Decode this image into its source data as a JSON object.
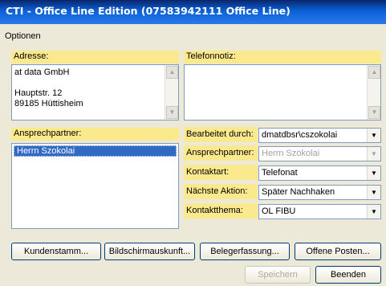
{
  "window": {
    "title": "CTI - Office Line Edition (07583942111 Office Line)"
  },
  "menu": {
    "optionen": "Optionen"
  },
  "address": {
    "label": "Adresse:",
    "text": "at data GmbH\n\nHauptstr. 12\n89185 Hüttisheim"
  },
  "telefonnotiz": {
    "label": "Telefonnotiz:",
    "text": ""
  },
  "contacts": {
    "label": "Ansprechpartner:",
    "items": [
      "Herrn Szokolai"
    ]
  },
  "form": {
    "bearbeitet": {
      "label": "Bearbeitet durch:",
      "value": "dmatdbsr\\cszokolai"
    },
    "ansprechpartner": {
      "label": "Ansprechpartner:",
      "value": "Herrn Szokolai"
    },
    "kontaktart": {
      "label": "Kontaktart:",
      "value": "Telefonat"
    },
    "naechste_aktion": {
      "label": "Nächste Aktion:",
      "value": "Später Nachhaken"
    },
    "kontaktthema": {
      "label": "Kontaktthema:",
      "value": "OL FIBU"
    }
  },
  "buttons": {
    "kundenstamm": "Kundenstamm...",
    "bildschirmauskunft": "Bildschirmauskunft...",
    "belegerfassung": "Belegerfassung...",
    "offene_posten": "Offene Posten...",
    "speichern": "Speichern",
    "beenden": "Beenden"
  },
  "colors": {
    "titlebar": "#0b61d8",
    "label_bg": "#fbe98d",
    "selection": "#316ac5",
    "window_bg": "#ece9d8"
  }
}
